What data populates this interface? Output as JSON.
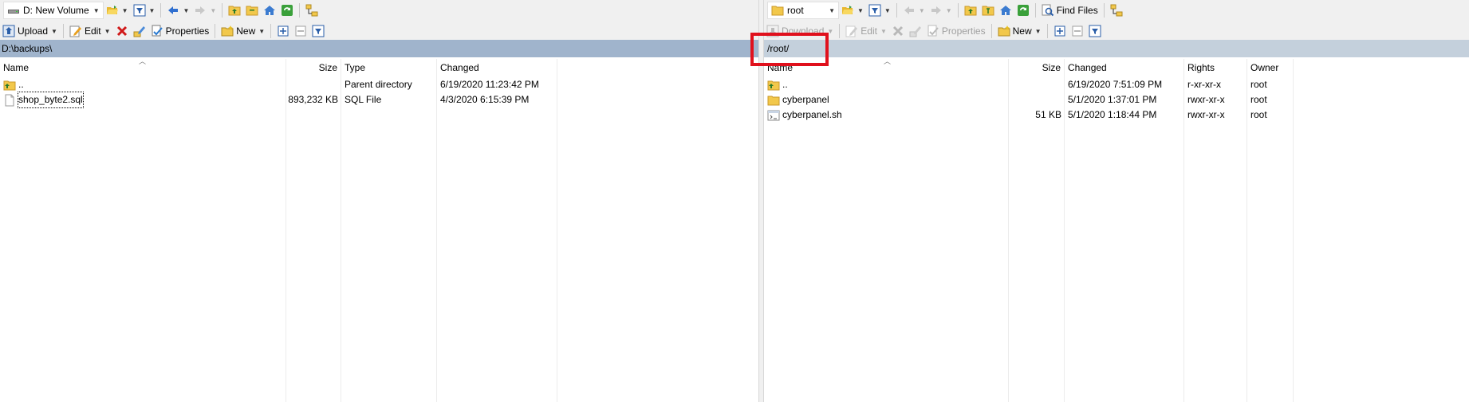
{
  "left": {
    "drive": "D: New Volume",
    "toolbar": {
      "upload": "Upload",
      "edit": "Edit",
      "properties": "Properties",
      "new": "New"
    },
    "path": "D:\\backups\\",
    "columns": {
      "name": "Name",
      "size": "Size",
      "type": "Type",
      "changed": "Changed"
    },
    "files": [
      {
        "name": "..",
        "size": "",
        "type": "Parent directory",
        "changed": "6/19/2020  11:23:42 PM"
      },
      {
        "name": "shop_byte2.sql",
        "size": "893,232 KB",
        "type": "SQL File",
        "changed": "4/3/2020  6:15:39 PM"
      }
    ]
  },
  "right": {
    "folder": "root",
    "find_files": "Find Files",
    "toolbar": {
      "download": "Download",
      "edit": "Edit",
      "properties": "Properties",
      "new": "New"
    },
    "path": "/root/",
    "columns": {
      "name": "Name",
      "size": "Size",
      "changed": "Changed",
      "rights": "Rights",
      "owner": "Owner"
    },
    "files": [
      {
        "name": "..",
        "size": "",
        "changed": "6/19/2020 7:51:09 PM",
        "rights": "r-xr-xr-x",
        "owner": "root"
      },
      {
        "name": "cyberpanel",
        "size": "",
        "changed": "5/1/2020 1:37:01 PM",
        "rights": "rwxr-xr-x",
        "owner": "root"
      },
      {
        "name": "cyberpanel.sh",
        "size": "51 KB",
        "changed": "5/1/2020 1:18:44 PM",
        "rights": "rwxr-xr-x",
        "owner": "root"
      }
    ]
  },
  "colors": {
    "highlight": "#e0101c",
    "active_path": "#a0b4cc",
    "inactive_path": "#c4d0dc",
    "folder": "#f2c84b"
  }
}
